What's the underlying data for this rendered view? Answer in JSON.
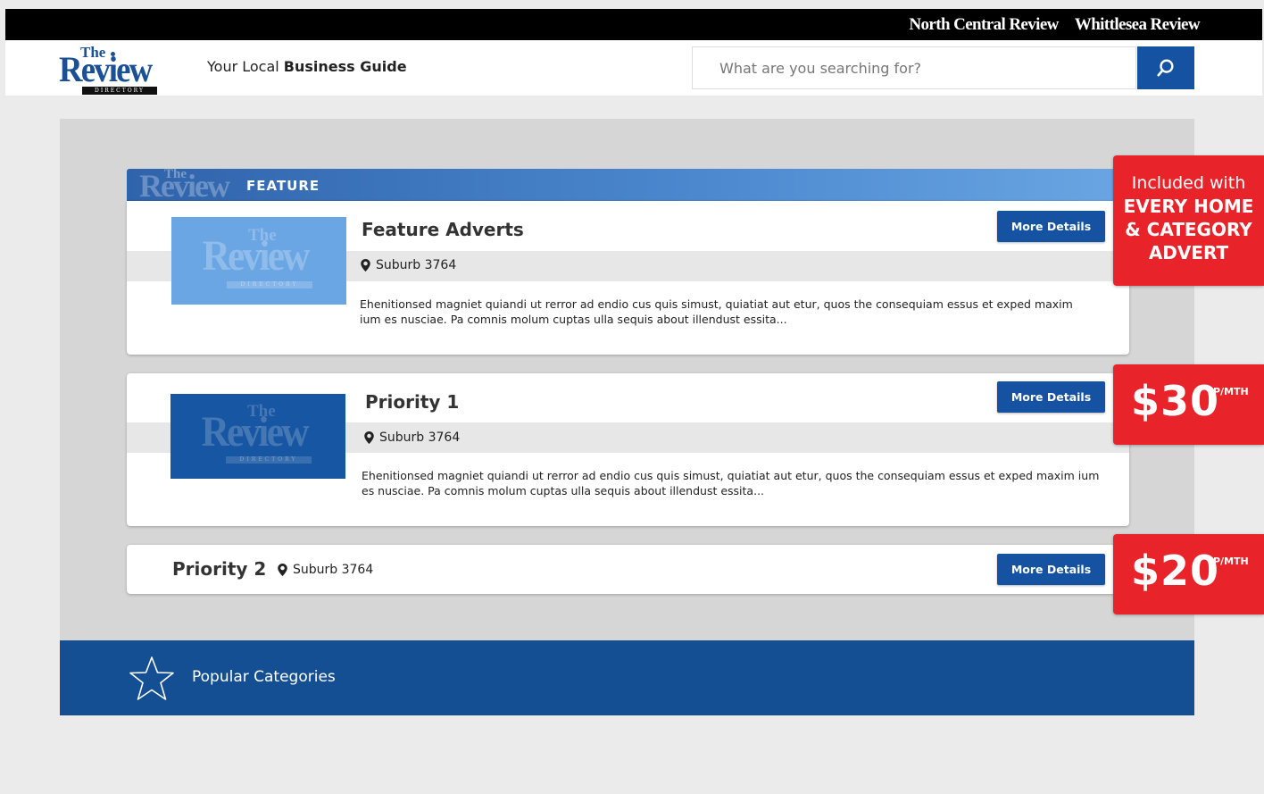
{
  "topbar": {
    "publications": [
      "North Central Review",
      "Whittlesea Review"
    ]
  },
  "header": {
    "logo": {
      "the": "The",
      "word": "Review",
      "sub": "DIRECTORY"
    },
    "tagline_prefix": "Your Local ",
    "tagline_bold": "Business Guide",
    "search_placeholder": "What are you searching for?"
  },
  "feature_band": {
    "label": "FEATURE",
    "ghost_the": "The",
    "ghost_word": "Review"
  },
  "listings": [
    {
      "title": "Feature Adverts",
      "location": "Suburb 3764",
      "description": "Ehenitionsed magniet quiandi ut rerror ad endio cus quis simust, quiatiat aut etur, quos the  consequiam essus et exped maxim ium es nusciae. Pa comnis molum cuptas ulla sequis about illendust essita...",
      "button": "More Details",
      "thumb": {
        "the": "The",
        "word": "Review",
        "sub": "DIRECTORY"
      }
    },
    {
      "title": "Priority 1",
      "location": "Suburb 3764",
      "description": "Ehenitionsed magniet quiandi ut rerror ad endio cus quis simust, quiatiat aut etur, quos the  consequiam essus et exped maxim ium es nusciae. Pa comnis molum cuptas ulla sequis about illendust essita...",
      "button": "More Details",
      "thumb": {
        "the": "The",
        "word": "Review",
        "sub": "DIRECTORY"
      }
    },
    {
      "title": "Priority 2",
      "location": "Suburb 3764",
      "button": "More Details"
    }
  ],
  "badges": {
    "feature": {
      "line1": "Included with",
      "line2": "EVERY HOME",
      "line3": "& CATEGORY",
      "line4": "ADVERT"
    },
    "priority1": {
      "price": "$30",
      "per": "P/MTH"
    },
    "priority2": {
      "price": "$20",
      "per": "P/MTH"
    }
  },
  "popular": {
    "label": "Popular Categories"
  },
  "colors": {
    "brand_blue": "#1552a1",
    "badge_red": "#e8232a",
    "footer_blue": "#134f92"
  },
  "icons": [
    "search-icon",
    "location-pin-icon",
    "star-icon"
  ]
}
